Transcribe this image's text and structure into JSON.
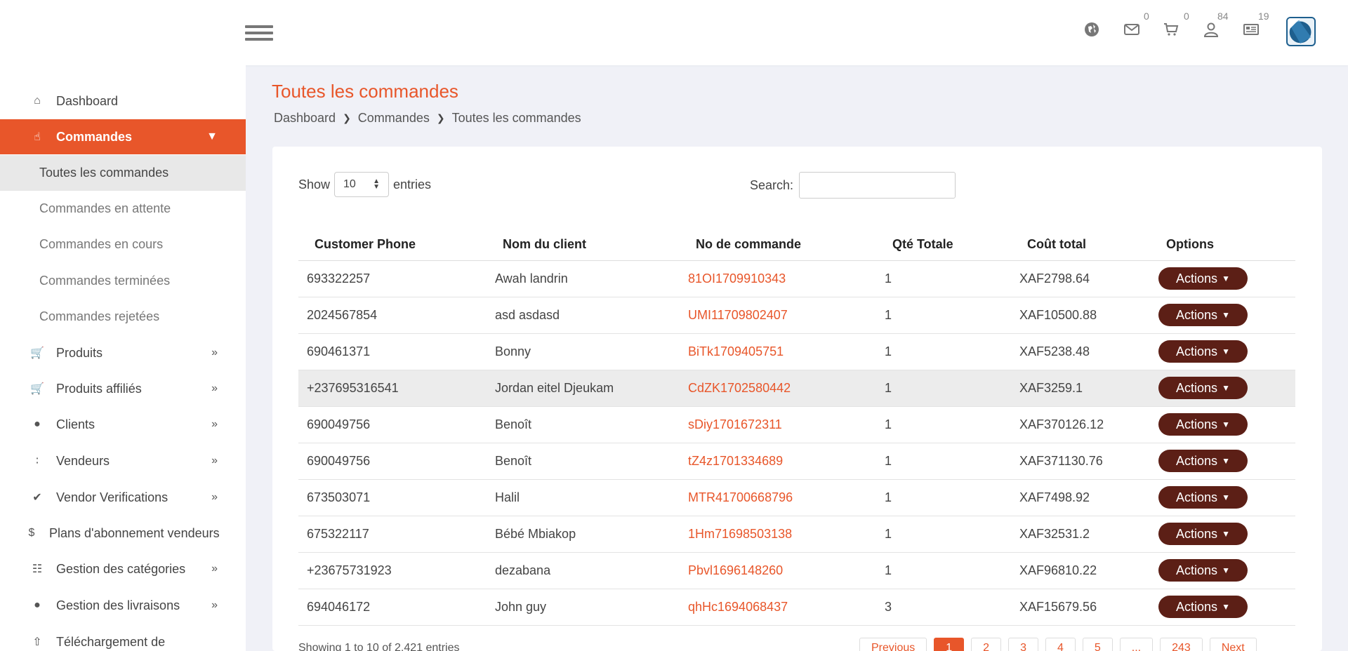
{
  "header": {
    "icons": [
      {
        "name": "globe-icon",
        "count": ""
      },
      {
        "name": "mail-icon",
        "count": "0"
      },
      {
        "name": "cart-icon",
        "count": "0"
      },
      {
        "name": "user-icon",
        "count": "84"
      },
      {
        "name": "news-icon",
        "count": "19"
      }
    ]
  },
  "sidebar": {
    "items": [
      {
        "label": "Dashboard",
        "icon": "home-icon"
      },
      {
        "label": "Commandes",
        "icon": "hand-box-icon"
      },
      {
        "label": "Produits",
        "icon": "cart-icon"
      },
      {
        "label": "Produits affiliés",
        "icon": "cart-icon"
      },
      {
        "label": "Clients",
        "icon": "user-icon"
      },
      {
        "label": "Vendeurs",
        "icon": "users-icon"
      },
      {
        "label": "Vendor Verifications",
        "icon": "check-icon"
      },
      {
        "label": "Plans d'abonnement vendeurs",
        "icon": "dollar-icon"
      },
      {
        "label": "Gestion des catégories",
        "icon": "sitemap-icon"
      },
      {
        "label": "Gestion des livraisons",
        "icon": "comment-icon"
      },
      {
        "label": "Téléchargement de",
        "icon": "upload-icon"
      }
    ],
    "sub_items": [
      "Toutes les commandes",
      "Commandes en attente",
      "Commandes en cours",
      "Commandes terminées",
      "Commandes rejetées"
    ]
  },
  "page": {
    "title": "Toutes les commandes",
    "breadcrumb": [
      "Dashboard",
      "Commandes",
      "Toutes les commandes"
    ]
  },
  "table_controls": {
    "show_label": "Show",
    "entries_value": "10",
    "entries_label": "entries",
    "search_label": "Search:"
  },
  "table": {
    "headers": [
      "Customer Phone",
      "Nom du client",
      "No de commande",
      "Qté Totale",
      "Coût total",
      "Options"
    ],
    "action_label": "Actions",
    "rows": [
      [
        "693322257",
        "Awah landrin",
        "81OI1709910343",
        "1",
        "XAF2798.64"
      ],
      [
        "2024567854",
        "asd asdasd",
        "UMI11709802407",
        "1",
        "XAF10500.88"
      ],
      [
        "690461371",
        "Bonny",
        "BiTk1709405751",
        "1",
        "XAF5238.48"
      ],
      [
        "+237695316541",
        "Jordan eitel Djeukam",
        "CdZK1702580442",
        "1",
        "XAF3259.1"
      ],
      [
        "690049756",
        "Benoît",
        "sDiy1701672311",
        "1",
        "XAF370126.12"
      ],
      [
        "690049756",
        "Benoît",
        "tZ4z1701334689",
        "1",
        "XAF371130.76"
      ],
      [
        "673503071",
        "Halil",
        "MTR41700668796",
        "1",
        "XAF7498.92"
      ],
      [
        "675322117",
        "Bébé Mbiakop",
        "1Hm71698503138",
        "1",
        "XAF32531.2"
      ],
      [
        "+23675731923",
        "dezabana",
        "Pbvl1696148260",
        "1",
        "XAF96810.22"
      ],
      [
        "694046172",
        "John guy",
        "qhHc1694068437",
        "3",
        "XAF15679.56"
      ]
    ]
  },
  "footer": {
    "showing": "Showing 1 to 10 of 2,421 entries",
    "pages": [
      "Previous",
      "1",
      "2",
      "3",
      "4",
      "5",
      "...",
      "243",
      "Next"
    ]
  },
  "colors": {
    "accent": "#e8562a",
    "action_button": "#5c1f16"
  }
}
